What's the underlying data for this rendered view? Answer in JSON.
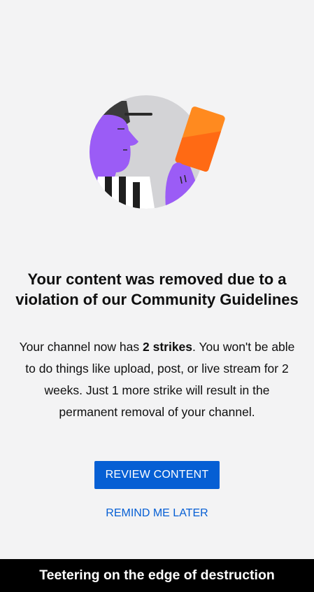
{
  "dialog": {
    "title": "Your content was removed due to a violation of our Community Guidelines",
    "message_before": "Your channel now has ",
    "message_strikes": "2 strikes",
    "message_after": ". You won't be able to do things like upload, post, or live stream for 2 weeks. Just 1 more strike will result in the permanent removal of your channel.",
    "primary_button_label": "REVIEW CONTENT",
    "secondary_button_label": "REMIND ME LATER"
  },
  "illustration": {
    "icon": "referee-red-card-icon"
  },
  "caption": {
    "text": "Teetering on the edge of destruction"
  },
  "colors": {
    "background": "#f3f3f4",
    "accent_blue": "#065fd4",
    "caption_bg": "#000000",
    "card_orange": "#ff7a1a",
    "figure_purple": "#9b5cf6"
  }
}
